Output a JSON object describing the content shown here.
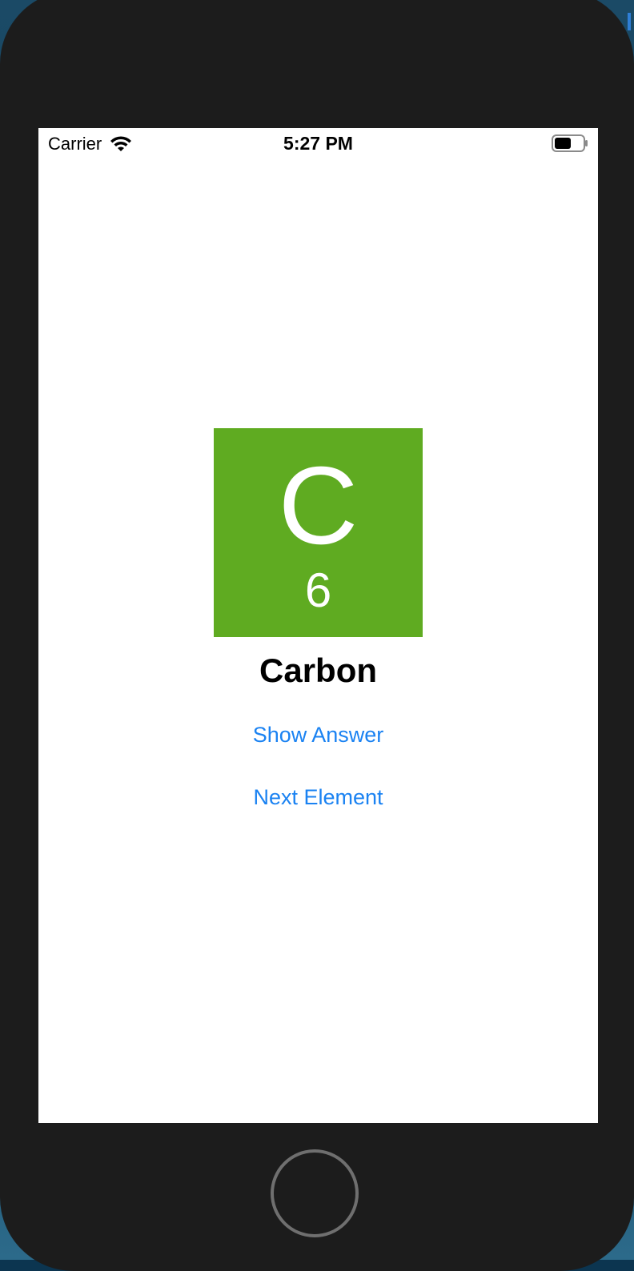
{
  "status_bar": {
    "carrier": "Carrier",
    "time": "5:27 PM",
    "wifi_icon": "wifi-icon",
    "battery_icon": "battery-icon"
  },
  "element": {
    "symbol": "C",
    "number": "6",
    "name": "Carbon",
    "tile_color": "#5fab21"
  },
  "actions": {
    "show_answer_label": "Show Answer",
    "next_element_label": "Next Element"
  },
  "colors": {
    "link": "#1a82f2",
    "device": "#1c1c1c"
  }
}
